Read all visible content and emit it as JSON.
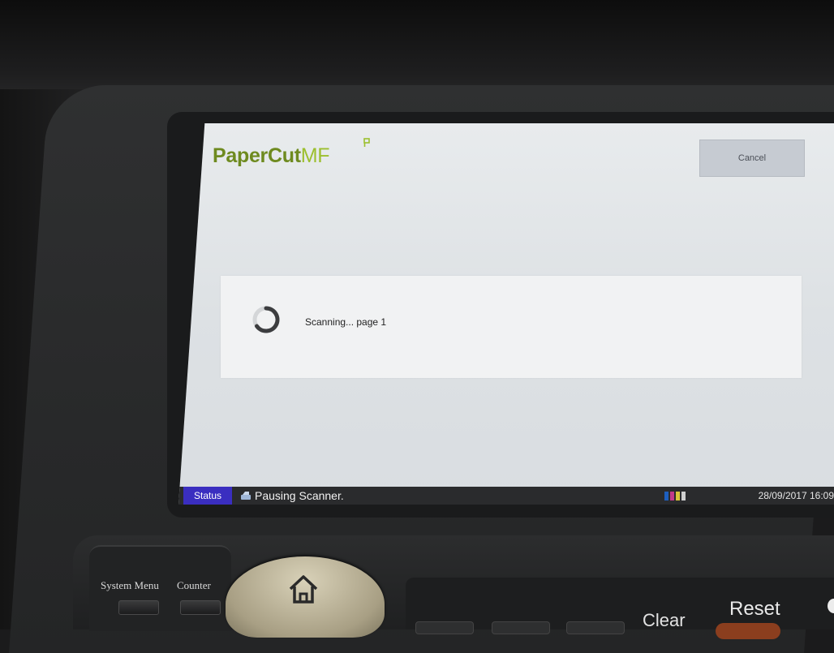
{
  "app": {
    "logo_main": "PaperCut",
    "logo_suffix": "MF",
    "cancel_label": "Cancel"
  },
  "progress": {
    "message": "Scanning... page 1"
  },
  "statusbar": {
    "status_label": "Status",
    "message": "Pausing Scanner.",
    "datetime": "28/09/2017 16:09"
  },
  "control_panel": {
    "system_menu_label": "System Menu",
    "counter_label": "Counter",
    "clear_label": "Clear",
    "reset_label": "Reset"
  },
  "icons": [
    "spinner-icon",
    "scanner-icon",
    "toner-icon",
    "home-icon",
    "logo-mark-icon"
  ],
  "colors": {
    "brand_green": "#6e8a1f",
    "status_blue": "#3a2ec0",
    "screen_bg": "#e3e6e9",
    "reset_orange": "#8b3e1e"
  }
}
